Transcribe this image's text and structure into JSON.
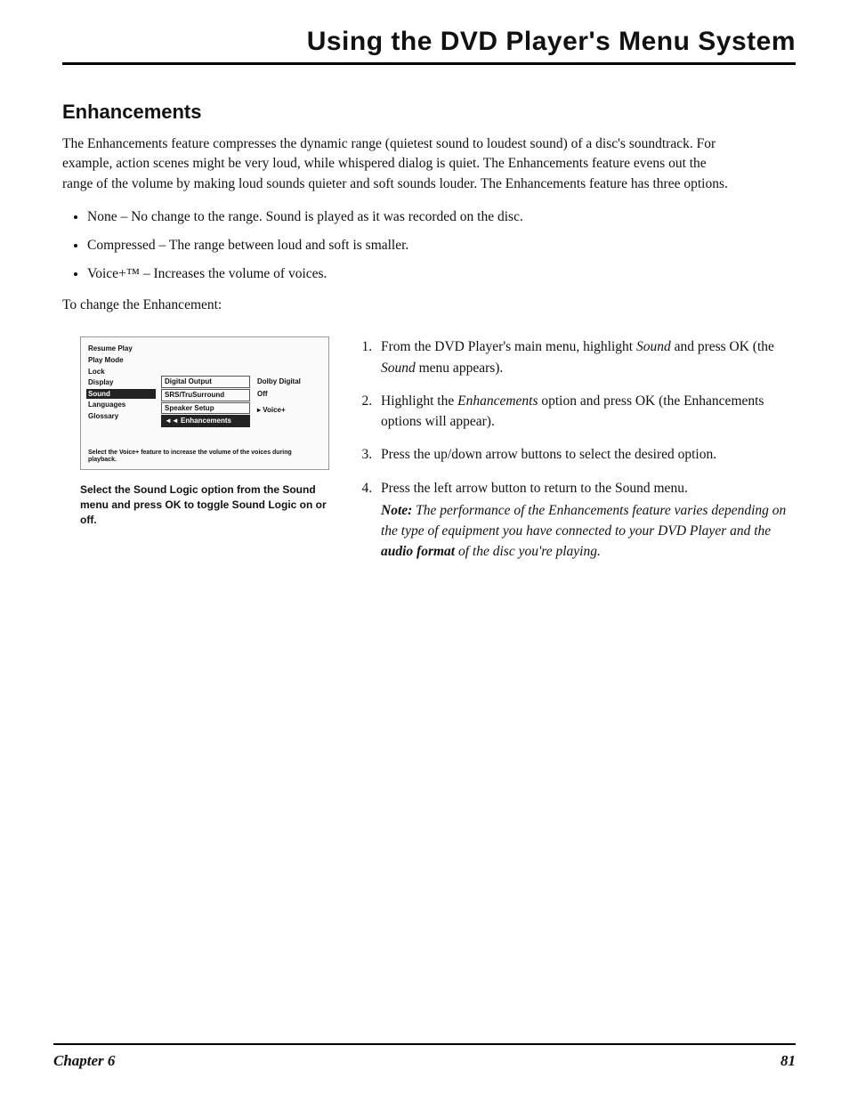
{
  "title": "Using the DVD Player's Menu System",
  "section_heading": "Enhancements",
  "intro": "The Enhancements feature compresses the dynamic range (quietest sound to loudest sound) of a disc's soundtrack. For example, action scenes might be very loud, while whispered dialog is quiet. The Enhancements feature evens out the range of the volume by making loud sounds quieter and soft sounds louder. The Enhancements feature has three options.",
  "options": [
    "None – No change to the range. Sound is played as it was recorded on the disc.",
    "Compressed – The range between loud and soft is smaller.",
    "Voice+™ – Increases the volume of voices."
  ],
  "lead_in": "To change the Enhancement:",
  "menu": {
    "left_items": [
      "Resume Play",
      "Play Mode",
      "Lock",
      "Display",
      "Sound",
      "Languages",
      "Glossary"
    ],
    "left_selected_index": 4,
    "mid_items": [
      "Digital Output",
      "SRS/TruSurround",
      "Speaker Setup",
      "◄◄  Enhancements"
    ],
    "mid_selected_index": 3,
    "right_items": [
      "Dolby Digital",
      "Off",
      "",
      "▸ Voice+"
    ],
    "hint": "Select the Voice+ feature to increase the volume of the voices during playback."
  },
  "caption": "Select the Sound Logic option from the Sound menu and press OK to toggle Sound Logic on or off.",
  "steps": [
    {
      "pre": "From the DVD Player's main menu, highlight ",
      "em1": "Sound",
      "mid": " and press OK (the ",
      "em2": "Sound",
      "post": " menu appears)."
    },
    {
      "pre": "Highlight the ",
      "em1": "Enhancements",
      "mid": " option and press OK (the Enhancements options will appear).",
      "em2": "",
      "post": ""
    },
    {
      "pre": "Press the up/down arrow buttons to select the desired option.",
      "em1": "",
      "mid": "",
      "em2": "",
      "post": ""
    },
    {
      "pre": "Press the left arrow button to return to the Sound menu.",
      "em1": "",
      "mid": "",
      "em2": "",
      "post": ""
    }
  ],
  "note": {
    "label": "Note:",
    "body1": " The performance of the Enhancements feature varies depending on the type of equipment you have connected to your DVD Player and the ",
    "bold": "audio format",
    "body2": " of the disc you're playing."
  },
  "footer": {
    "chapter": "Chapter 6",
    "page": "81"
  }
}
